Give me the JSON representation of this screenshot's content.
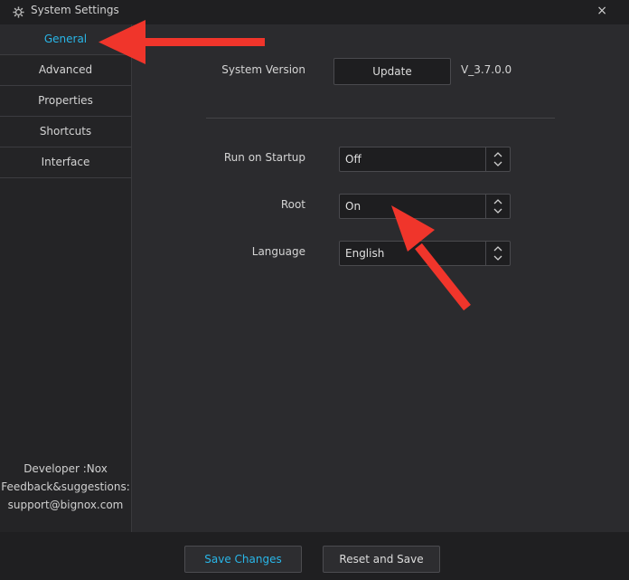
{
  "window": {
    "title": "System Settings",
    "close_glyph": "×"
  },
  "sidebar": {
    "items": [
      {
        "label": "General",
        "active": true
      },
      {
        "label": "Advanced",
        "active": false
      },
      {
        "label": "Properties",
        "active": false
      },
      {
        "label": "Shortcuts",
        "active": false
      },
      {
        "label": "Interface",
        "active": false
      }
    ],
    "footer": {
      "developer": "Developer :Nox",
      "feedback": "Feedback&suggestions:",
      "email": "support@bignox.com"
    }
  },
  "general": {
    "system_version_label": "System Version",
    "update_button": "Update",
    "version": "V_3.7.0.0",
    "run_on_startup_label": "Run on Startup",
    "run_on_startup_value": "Off",
    "root_label": "Root",
    "root_value": "On",
    "language_label": "Language",
    "language_value": "English"
  },
  "footer": {
    "save_label": "Save Changes",
    "reset_label": "Reset and Save"
  },
  "colors": {
    "accent": "#29b6e8",
    "annotation_arrow": "#f0352b"
  }
}
